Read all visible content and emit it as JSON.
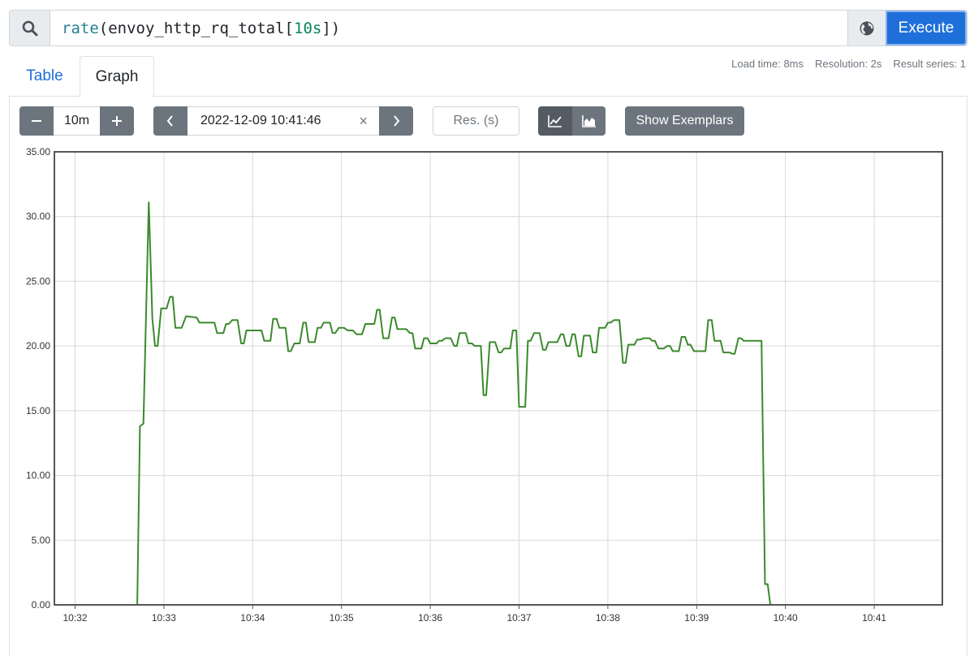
{
  "query_bar": {
    "expression": {
      "fn": "rate",
      "open": "(",
      "metric": "envoy_http_rq_total[",
      "duration": "10s",
      "close": "])"
    },
    "search_icon": "search-icon",
    "globe_icon": "globe-icon",
    "execute_label": "Execute"
  },
  "tabs": [
    {
      "label": "Table",
      "active": false
    },
    {
      "label": "Graph",
      "active": true
    }
  ],
  "stats": {
    "load_time": "Load time: 8ms",
    "resolution": "Resolution: 2s",
    "result_series": "Result series: 1"
  },
  "controls": {
    "range_minus_icon": "minus-icon",
    "range_value": "10m",
    "range_plus_icon": "plus-icon",
    "prev_icon": "chevron-left-icon",
    "end_time": "2022-12-09 10:41:46",
    "clear_icon": "close-icon",
    "clear_glyph": "×",
    "next_icon": "chevron-right-icon",
    "resolution_placeholder": "Res. (s)",
    "line_mode_icon": "line-chart-icon",
    "stacked_mode_icon": "area-chart-icon",
    "show_exemplars": "Show Exemplars",
    "line_color": "#3a8a2c",
    "accent": "#1e6fd9"
  },
  "chart_data": {
    "type": "line",
    "ylim": [
      0,
      35
    ],
    "y_ticks": [
      "0.00",
      "5.00",
      "10.00",
      "15.00",
      "20.00",
      "25.00",
      "30.00",
      "35.00"
    ],
    "x_ticks": [
      "10:32",
      "10:33",
      "10:34",
      "10:35",
      "10:36",
      "10:37",
      "10:38",
      "10:39",
      "10:40",
      "10:41"
    ],
    "x_tick_minutes": [
      32,
      33,
      34,
      35,
      36,
      37,
      38,
      39,
      40,
      41
    ],
    "xlim_minutes": [
      31.767,
      41.767
    ],
    "grid": true,
    "series": [
      {
        "color": "#3a8a2c",
        "points": [
          [
            32.3,
            0
          ],
          [
            32.7,
            0
          ],
          [
            32.73,
            13.8
          ],
          [
            32.77,
            14.0
          ],
          [
            32.83,
            31.1
          ],
          [
            32.87,
            22.1
          ],
          [
            32.9,
            20.0
          ],
          [
            32.93,
            20.0
          ],
          [
            32.97,
            22.9
          ],
          [
            33.03,
            22.9
          ],
          [
            33.07,
            23.8
          ],
          [
            33.1,
            23.8
          ],
          [
            33.13,
            21.4
          ],
          [
            33.2,
            21.4
          ],
          [
            33.25,
            22.3
          ],
          [
            33.37,
            22.2
          ],
          [
            33.4,
            21.8
          ],
          [
            33.57,
            21.8
          ],
          [
            33.6,
            21.0
          ],
          [
            33.67,
            21.0
          ],
          [
            33.7,
            21.7
          ],
          [
            33.73,
            21.7
          ],
          [
            33.77,
            22.0
          ],
          [
            33.83,
            22.0
          ],
          [
            33.87,
            20.2
          ],
          [
            33.9,
            20.2
          ],
          [
            33.93,
            21.2
          ],
          [
            34.1,
            21.2
          ],
          [
            34.13,
            20.4
          ],
          [
            34.2,
            20.4
          ],
          [
            34.23,
            22.1
          ],
          [
            34.27,
            22.1
          ],
          [
            34.3,
            21.4
          ],
          [
            34.37,
            21.4
          ],
          [
            34.4,
            19.6
          ],
          [
            34.43,
            19.6
          ],
          [
            34.47,
            20.2
          ],
          [
            34.53,
            20.2
          ],
          [
            34.57,
            21.8
          ],
          [
            34.6,
            21.8
          ],
          [
            34.63,
            20.3
          ],
          [
            34.7,
            20.3
          ],
          [
            34.73,
            21.4
          ],
          [
            34.77,
            21.4
          ],
          [
            34.8,
            21.8
          ],
          [
            34.87,
            21.8
          ],
          [
            34.9,
            21.0
          ],
          [
            34.93,
            21.0
          ],
          [
            34.97,
            21.4
          ],
          [
            35.03,
            21.4
          ],
          [
            35.07,
            21.2
          ],
          [
            35.13,
            21.2
          ],
          [
            35.17,
            20.9
          ],
          [
            35.23,
            20.9
          ],
          [
            35.27,
            21.7
          ],
          [
            35.37,
            21.7
          ],
          [
            35.4,
            22.8
          ],
          [
            35.43,
            22.8
          ],
          [
            35.47,
            20.6
          ],
          [
            35.53,
            20.6
          ],
          [
            35.57,
            22.2
          ],
          [
            35.6,
            22.2
          ],
          [
            35.63,
            21.3
          ],
          [
            35.73,
            21.3
          ],
          [
            35.77,
            21.0
          ],
          [
            35.8,
            21.0
          ],
          [
            35.83,
            19.8
          ],
          [
            35.9,
            19.8
          ],
          [
            35.93,
            20.6
          ],
          [
            35.97,
            20.6
          ],
          [
            36.0,
            20.2
          ],
          [
            36.07,
            20.2
          ],
          [
            36.1,
            20.4
          ],
          [
            36.13,
            20.4
          ],
          [
            36.17,
            20.6
          ],
          [
            36.23,
            20.6
          ],
          [
            36.27,
            20.0
          ],
          [
            36.3,
            20.0
          ],
          [
            36.33,
            21.0
          ],
          [
            36.4,
            21.0
          ],
          [
            36.43,
            20.2
          ],
          [
            36.47,
            20.2
          ],
          [
            36.5,
            20.0
          ],
          [
            36.57,
            20.0
          ],
          [
            36.6,
            16.2
          ],
          [
            36.63,
            16.2
          ],
          [
            36.67,
            20.3
          ],
          [
            36.73,
            20.3
          ],
          [
            36.77,
            19.5
          ],
          [
            36.8,
            19.5
          ],
          [
            36.83,
            19.8
          ],
          [
            36.9,
            19.8
          ],
          [
            36.93,
            21.2
          ],
          [
            36.97,
            21.2
          ],
          [
            37.0,
            15.3
          ],
          [
            37.07,
            15.3
          ],
          [
            37.1,
            20.4
          ],
          [
            37.13,
            20.4
          ],
          [
            37.17,
            21.0
          ],
          [
            37.23,
            21.0
          ],
          [
            37.27,
            19.7
          ],
          [
            37.3,
            19.7
          ],
          [
            37.33,
            20.3
          ],
          [
            37.43,
            20.3
          ],
          [
            37.47,
            20.9
          ],
          [
            37.5,
            20.9
          ],
          [
            37.53,
            20.0
          ],
          [
            37.57,
            20.0
          ],
          [
            37.6,
            20.9
          ],
          [
            37.63,
            20.9
          ],
          [
            37.67,
            19.2
          ],
          [
            37.7,
            19.2
          ],
          [
            37.73,
            20.8
          ],
          [
            37.8,
            20.8
          ],
          [
            37.83,
            19.5
          ],
          [
            37.87,
            19.5
          ],
          [
            37.9,
            21.4
          ],
          [
            37.97,
            21.4
          ],
          [
            38.0,
            21.8
          ],
          [
            38.03,
            21.8
          ],
          [
            38.07,
            22.0
          ],
          [
            38.13,
            22.0
          ],
          [
            38.17,
            18.7
          ],
          [
            38.2,
            18.7
          ],
          [
            38.23,
            20.1
          ],
          [
            38.3,
            20.1
          ],
          [
            38.33,
            20.5
          ],
          [
            38.37,
            20.5
          ],
          [
            38.4,
            20.6
          ],
          [
            38.47,
            20.6
          ],
          [
            38.5,
            20.4
          ],
          [
            38.53,
            20.4
          ],
          [
            38.57,
            19.8
          ],
          [
            38.63,
            19.8
          ],
          [
            38.67,
            20.0
          ],
          [
            38.7,
            20.0
          ],
          [
            38.73,
            19.6
          ],
          [
            38.8,
            19.6
          ],
          [
            38.83,
            20.7
          ],
          [
            38.87,
            20.7
          ],
          [
            38.9,
            20.1
          ],
          [
            38.93,
            20.1
          ],
          [
            38.97,
            19.6
          ],
          [
            39.1,
            19.6
          ],
          [
            39.13,
            22.0
          ],
          [
            39.17,
            22.0
          ],
          [
            39.2,
            20.4
          ],
          [
            39.27,
            20.4
          ],
          [
            39.3,
            19.5
          ],
          [
            39.37,
            19.5
          ],
          [
            39.4,
            19.4
          ],
          [
            39.43,
            19.4
          ],
          [
            39.47,
            20.6
          ],
          [
            39.5,
            20.6
          ],
          [
            39.53,
            20.4
          ],
          [
            39.73,
            20.4
          ],
          [
            39.77,
            1.6
          ],
          [
            39.8,
            1.6
          ],
          [
            39.83,
            0
          ],
          [
            41.767,
            0
          ]
        ]
      }
    ]
  }
}
